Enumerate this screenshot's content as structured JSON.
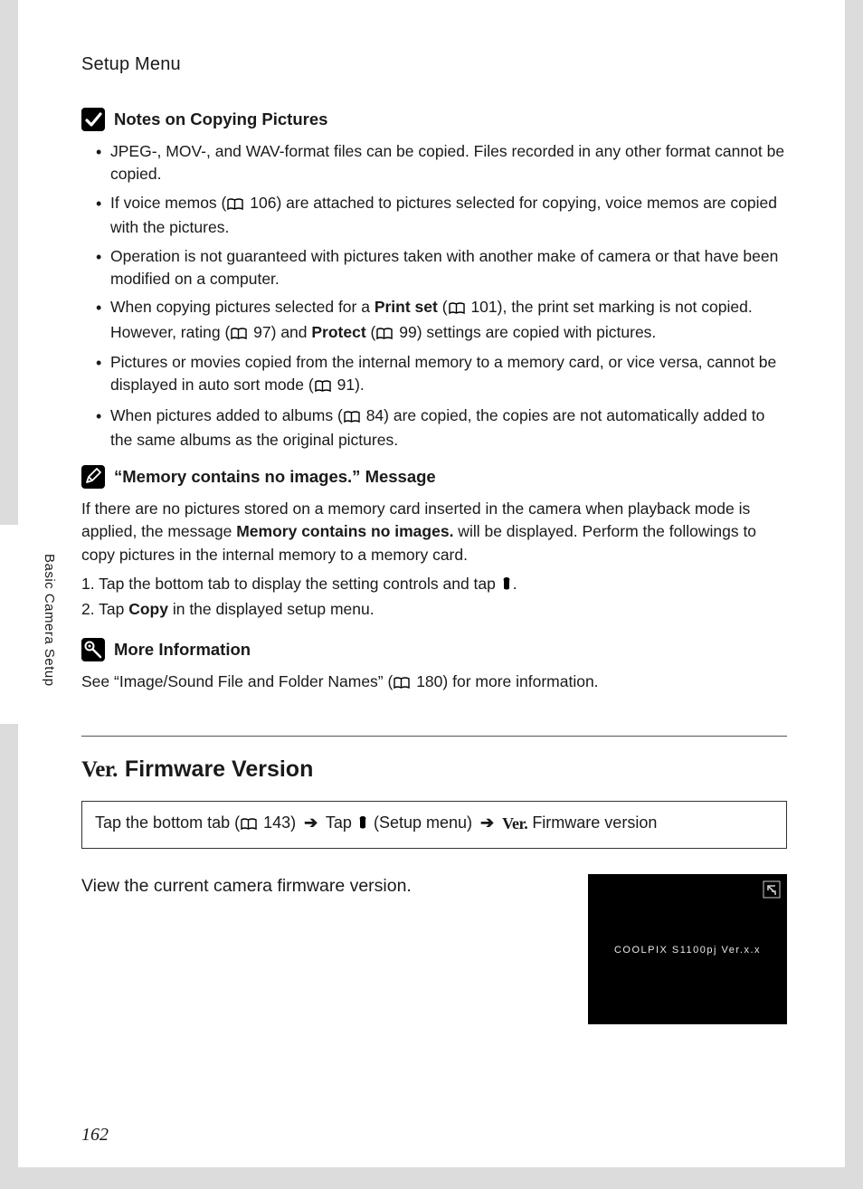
{
  "header": {
    "title": "Setup Menu"
  },
  "sideLabel": "Basic Camera Setup",
  "pageNumber": "162",
  "notesCopying": {
    "heading": "Notes on Copying Pictures",
    "items": [
      {
        "text": "JPEG-, MOV-, and WAV-format files can be copied. Files recorded in any other format cannot be copied."
      },
      {
        "pre": "If voice memos (",
        "ref": "106",
        "post": ") are attached to pictures selected for copying, voice memos are copied with the pictures."
      },
      {
        "text": "Operation is not guaranteed with pictures taken with another make of camera or that have been modified on a computer."
      },
      {
        "pre": "When copying pictures selected for a ",
        "b1": "Print set",
        "mid1": " (",
        "ref1": "101",
        "mid2": "), the print set marking is not copied. However, rating (",
        "ref2": "97",
        "mid3": ") and ",
        "b2": "Protect",
        "mid4": " (",
        "ref3": "99",
        "post": ") settings are copied with pictures."
      },
      {
        "pre": "Pictures or movies copied from the internal memory to a memory card, or vice versa, cannot be displayed in auto sort mode (",
        "ref": "91",
        "post": ")."
      },
      {
        "pre": "When pictures added to albums (",
        "ref": "84",
        "post": ") are copied, the copies are not automatically added to the same albums as the original pictures."
      }
    ]
  },
  "memoryMsg": {
    "heading": "“Memory contains no images.” Message",
    "bodyPre": "If there are no pictures stored on a memory card inserted in the camera when playback mode is applied, the message ",
    "bodyBold": "Memory contains no images.",
    "bodyPost": " will be displayed. Perform the followings to copy pictures in the internal memory to a memory card.",
    "step1pre": "1.  Tap the bottom tab to display the setting controls and tap ",
    "step1post": ".",
    "step2pre": "2.  Tap ",
    "step2b": "Copy",
    "step2post": " in the displayed setup menu."
  },
  "moreInfo": {
    "heading": "More Information",
    "pre": "See “Image/Sound File and Folder Names” (",
    "ref": "180",
    "post": ") for more information."
  },
  "firmware": {
    "heading": "Firmware Version",
    "crumbPre": "Tap the bottom tab (",
    "crumbRef": "143",
    "crumbMid1": ") ",
    "crumbMid2": " Tap ",
    "crumbMid3": " (Setup menu) ",
    "crumbPost": " Firmware version",
    "body": "View the current camera firmware version.",
    "screenText": "COOLPIX S1100pj Ver.x.x"
  }
}
